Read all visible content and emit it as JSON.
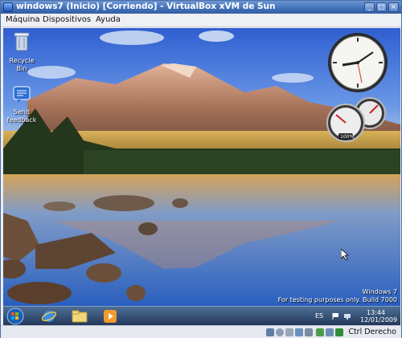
{
  "window": {
    "title": "windows7 (Inicio) [Corriendo] - VirtualBox xVM de Sun"
  },
  "menu": {
    "items": [
      "Máquina",
      "Dispositivos",
      "Ayuda"
    ]
  },
  "desktop": {
    "icons": [
      {
        "label": "Recycle Bin",
        "icon": "recycle-bin-icon"
      },
      {
        "label": "Send feedback",
        "icon": "feedback-icon"
      }
    ],
    "watermark": {
      "line1": "Windows  7",
      "line2": "For testing purposes only. Build 7000"
    },
    "gadgets": {
      "clock": "analog clock gadget",
      "cpu_meter_value": "100%"
    }
  },
  "taskbar": {
    "pinned": [
      "internet-explorer-icon",
      "windows-explorer-icon",
      "media-player-icon"
    ],
    "language": "ES",
    "time": "13:44",
    "date": "12/01/2009"
  },
  "statusbar": {
    "host_key": "Ctrl Derecho"
  },
  "colors": {
    "titlebar": "#3f6fb8",
    "taskbar": "#23385a",
    "desktop_sky": "#2f5fd0"
  }
}
